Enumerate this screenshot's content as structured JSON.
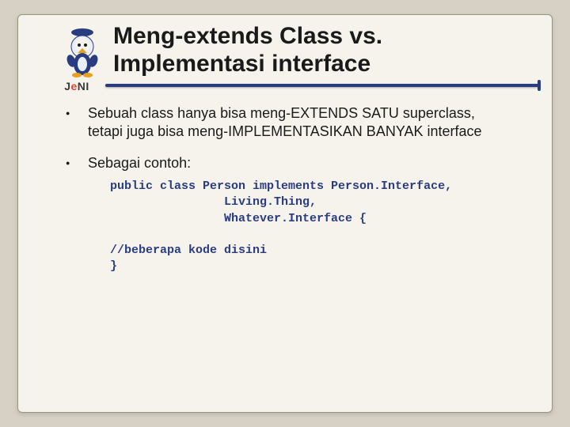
{
  "title_line1": "Meng-extends Class vs.",
  "title_line2": "Implementasi interface",
  "brand_prefix": "J",
  "brand_accent": "e",
  "brand_suffix": "NI",
  "bullets": [
    "Sebuah class hanya bisa meng-EXTENDS SATU superclass, tetapi juga bisa meng-IMPLEMENTASIKAN BANYAK interface",
    "Sebagai contoh:"
  ],
  "code": "public class Person implements Person.Interface,\n                Living.Thing,\n                Whatever.Interface {\n\n//beberapa kode disini\n}"
}
